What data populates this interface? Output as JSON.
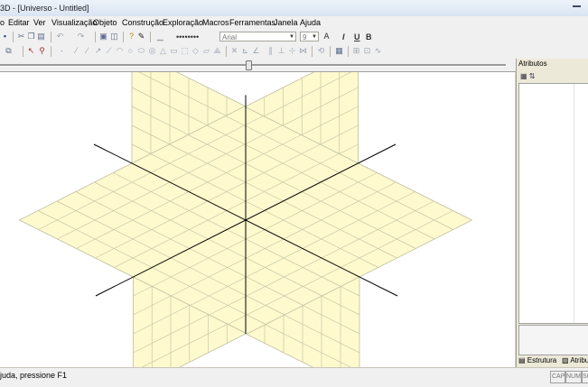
{
  "window": {
    "title": "3D - [Universo - Untitled]"
  },
  "menu": [
    "o",
    "Editar",
    "Ver",
    "Visualização",
    "Objeto",
    "Construção",
    "Exploração",
    "Macros",
    "Ferramentas",
    "Janela",
    "Ajuda"
  ],
  "toolbar": {
    "font_name": "Arial",
    "font_size": "9",
    "line_style_label": "••••••••"
  },
  "panel": {
    "title": "Atributos",
    "tab_structure": "Estrutura",
    "tab_attributes": "Atribu"
  },
  "status": {
    "message": "juda, pressione F1",
    "indicators": [
      "CAP",
      "NUM",
      "SC"
    ]
  },
  "colors": {
    "plane_fill": "#fffacd",
    "grid_line": "#c6c6a8",
    "axis": "#000000"
  }
}
